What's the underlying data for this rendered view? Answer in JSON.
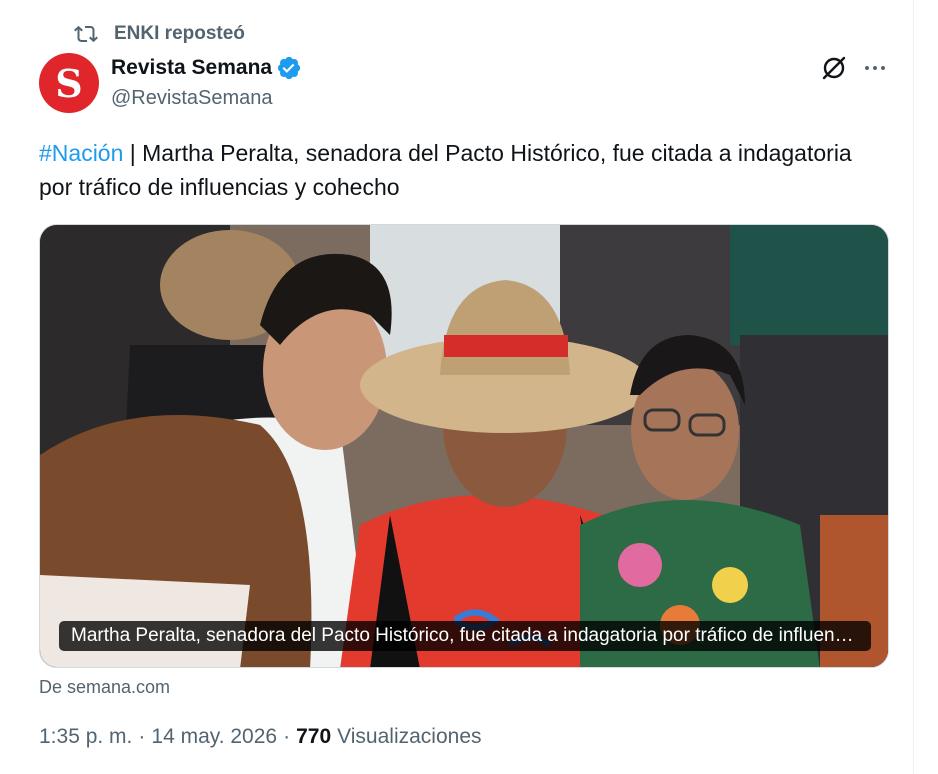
{
  "repost": {
    "label": "ENKI reposteó",
    "icon": "repost-icon"
  },
  "author": {
    "avatar_letter": "S",
    "avatar_color": "#e0262a",
    "name": "Revista Semana",
    "handle": "@RevistaSemana",
    "verified_color": "#1d9bf0"
  },
  "actions": {
    "grok_icon": "grok-icon",
    "more_icon": "more-icon"
  },
  "tweet": {
    "hashtag": "#Nación",
    "text": " | Martha Peralta, senadora del Pacto Histórico, fue citada a indagatoria por tráfico de influencias y cohecho"
  },
  "card": {
    "caption": "Martha Peralta, senadora del Pacto Histórico, fue citada a indagatoria por tráfico de influencias y cohecho",
    "source": "De semana.com"
  },
  "meta": {
    "time": "1:35 p. m.",
    "date": "14 may. 2026",
    "views_count": "770",
    "views_label": "Visualizaciones"
  },
  "colors": {
    "accent": "#1d9bf0",
    "secondary_text": "#536471",
    "text": "#0f1419"
  }
}
